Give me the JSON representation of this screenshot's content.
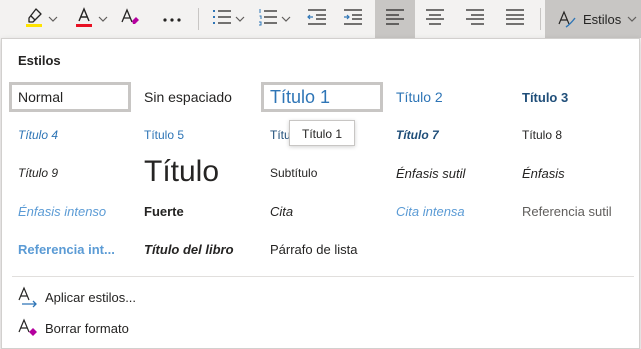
{
  "toolbar": {
    "styles_button_label": "Estilos",
    "icons": [
      "highlighter-icon",
      "font-color-icon",
      "clear-formatting-icon",
      "more-options-icon",
      "bullet-list-icon",
      "numbered-list-icon",
      "decrease-indent-icon",
      "increase-indent-icon",
      "align-left-icon",
      "align-center-icon",
      "align-right-icon",
      "justify-icon",
      "styles-icon"
    ],
    "highlight_color": "#ffe300",
    "font_color": "#e81123"
  },
  "styles_panel": {
    "title": "Estilos",
    "styles": [
      {
        "label": "Normal",
        "color": "#252423"
      },
      {
        "label": "Sin espaciado",
        "color": "#252423"
      },
      {
        "label": "Título 1",
        "color": "#2e75b6"
      },
      {
        "label": "Título 2",
        "color": "#2e75b6"
      },
      {
        "label": "Título 3",
        "color": "#1f4e79"
      },
      {
        "label": "Título 4",
        "color": "#2e75b6"
      },
      {
        "label": "Título 5",
        "color": "#2e75b6"
      },
      {
        "label": "Título 6",
        "color": "#1f4e79"
      },
      {
        "label": "Título 7",
        "color": "#1f4e79"
      },
      {
        "label": "Título 8",
        "color": "#252423"
      },
      {
        "label": "Título 9",
        "color": "#252423"
      },
      {
        "label": "Título",
        "color": "#252423"
      },
      {
        "label": "Subtítulo",
        "color": "#252423"
      },
      {
        "label": "Énfasis sutil",
        "color": "#252423"
      },
      {
        "label": "Énfasis",
        "color": "#252423"
      },
      {
        "label": "Énfasis intenso",
        "color": "#5b9bd5"
      },
      {
        "label": "Fuerte",
        "color": "#252423"
      },
      {
        "label": "Cita",
        "color": "#252423"
      },
      {
        "label": "Cita intensa",
        "color": "#5b9bd5"
      },
      {
        "label": "Referencia sutil",
        "color": "#605e5c"
      },
      {
        "label": "Referencia int...",
        "color": "#5b9bd5"
      },
      {
        "label": "Título del libro",
        "color": "#252423"
      },
      {
        "label": "Párrafo de lista",
        "color": "#252423"
      }
    ],
    "selected": "Normal",
    "hovered": "Título 1",
    "tooltip": "Título 1",
    "actions": [
      {
        "label": "Aplicar estilos...",
        "icon": "apply-styles-icon"
      },
      {
        "label": "Borrar formato",
        "icon": "clear-formatting-icon"
      }
    ]
  }
}
